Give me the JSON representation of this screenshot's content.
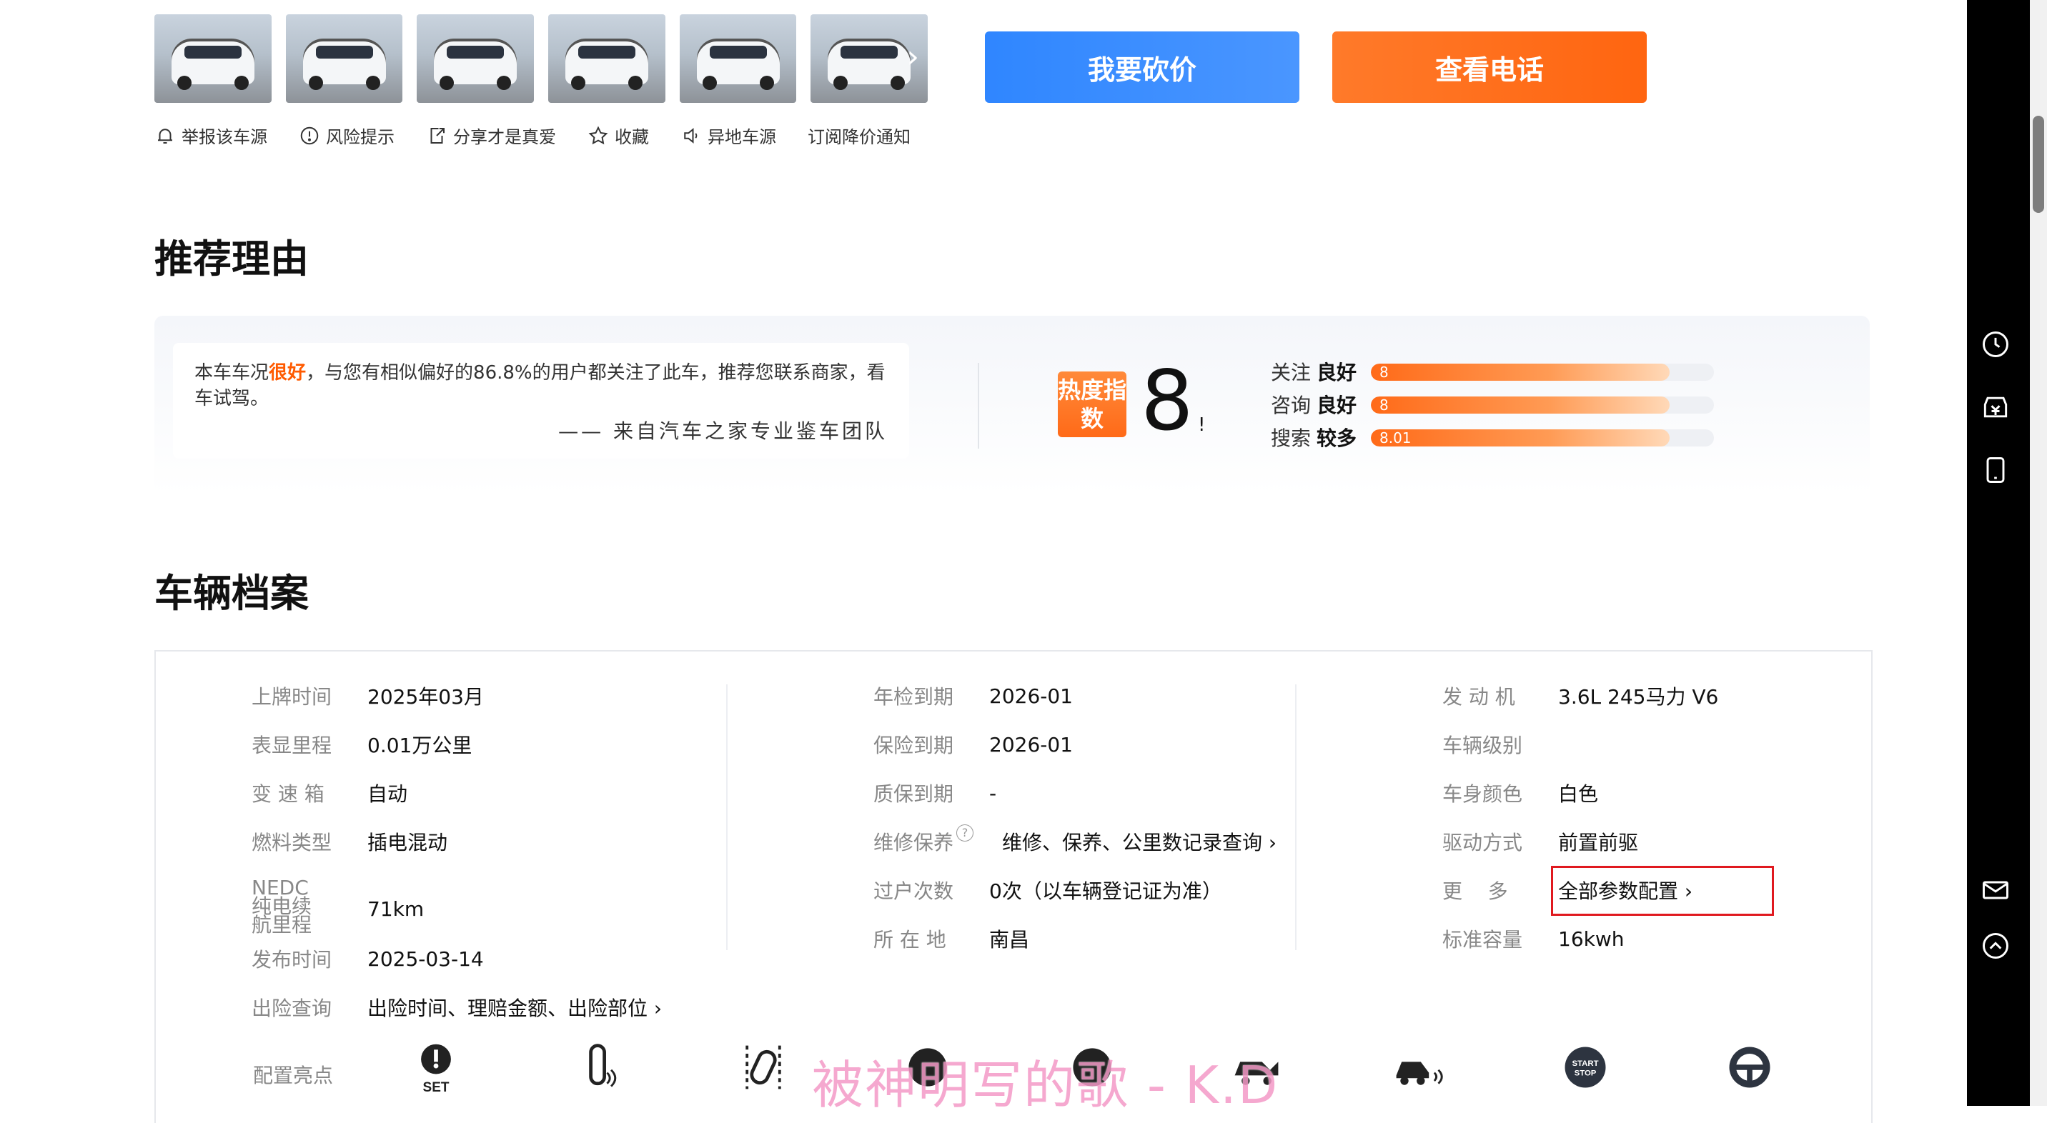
{
  "gallery": {
    "thumb_count": 6,
    "next_icon": "chevron-right-icon"
  },
  "actions": [
    {
      "icon": "bell-icon",
      "label": "举报该车源"
    },
    {
      "icon": "alert-circle-icon",
      "label": "风险提示"
    },
    {
      "icon": "share-icon",
      "label": "分享才是真爱"
    },
    {
      "icon": "star-icon",
      "label": "收藏"
    },
    {
      "icon": "speaker-icon",
      "label": "异地车源"
    },
    {
      "icon": "",
      "label": "订阅降价通知"
    }
  ],
  "buttons": {
    "bargain": "我要砍价",
    "phone": "查看电话"
  },
  "recommend": {
    "title": "推荐理由",
    "text_before": "本车车况",
    "highlight": "很好",
    "text_after": "，与您有相似偏好的86.8%的用户都关注了此车，推荐您联系商家，看车试驾。",
    "signature": "—— 来自汽车之家专业鉴车团队",
    "heat_badge": "热度指数",
    "heat_value": "8",
    "heat_mark": "!",
    "bars": [
      {
        "label": "关注",
        "level": "良好",
        "value": "8",
        "fill": 0.87
      },
      {
        "label": "咨询",
        "level": "良好",
        "value": "8",
        "fill": 0.87
      },
      {
        "label": "搜索",
        "level": "较多",
        "value": "8.01",
        "fill": 0.87
      }
    ]
  },
  "archive": {
    "title": "车辆档案",
    "col1": [
      {
        "k": "上牌时间",
        "v": "2025年03月"
      },
      {
        "k": "表显里程",
        "v": "0.01万公里"
      },
      {
        "k": "变 速 箱",
        "v": "自动"
      },
      {
        "k": "燃料类型",
        "v": "插电混动"
      },
      {
        "k": "NEDC纯电续航里程",
        "v": "71km"
      },
      {
        "k": "发布时间",
        "v": "2025-03-14"
      },
      {
        "k": "出险查询",
        "v": "出险时间、理赔金额、出险部位"
      }
    ],
    "col2": [
      {
        "k": "年检到期",
        "v": "2026-01"
      },
      {
        "k": "保险到期",
        "v": "2026-01"
      },
      {
        "k": "质保到期",
        "v": "-"
      },
      {
        "k": "维修保养",
        "v": "维修、保养、公里数记录查询"
      },
      {
        "k": "过户次数",
        "v": "0次（以车辆登记证为准）"
      },
      {
        "k": "所 在 地",
        "v": "南昌"
      }
    ],
    "col3": [
      {
        "k": "发 动 机",
        "v": "3.6L 245马力 V6"
      },
      {
        "k": "车辆级别",
        "v": ""
      },
      {
        "k": "车身颜色",
        "v": "白色"
      },
      {
        "k": "驱动方式",
        "v": "前置前驱"
      },
      {
        "k": "更    多",
        "v": "全部参数配置"
      },
      {
        "k": "标准容量",
        "v": "16kwh"
      }
    ]
  },
  "config": {
    "label": "配置亮点",
    "icons": [
      "tpms-set-icon",
      "key-icon",
      "door-icon",
      "steering-icon",
      "car-icon",
      "trunk-icon",
      "parking-sensor-icon",
      "start-stop-icon",
      "steering-wheel-icon"
    ],
    "set_text": "SET",
    "start_text": "START STOP"
  },
  "watermark": "被神明写的歌 - K.D",
  "rail": {
    "icons": [
      "clock-icon",
      "price-tag-icon",
      "mobile-icon",
      "mail-icon",
      "arrow-up-icon"
    ]
  },
  "colors": {
    "accent_orange": "#ff5a00",
    "bargain_blue": "#2f86ff",
    "phone_orange": "#ff7a2a"
  }
}
